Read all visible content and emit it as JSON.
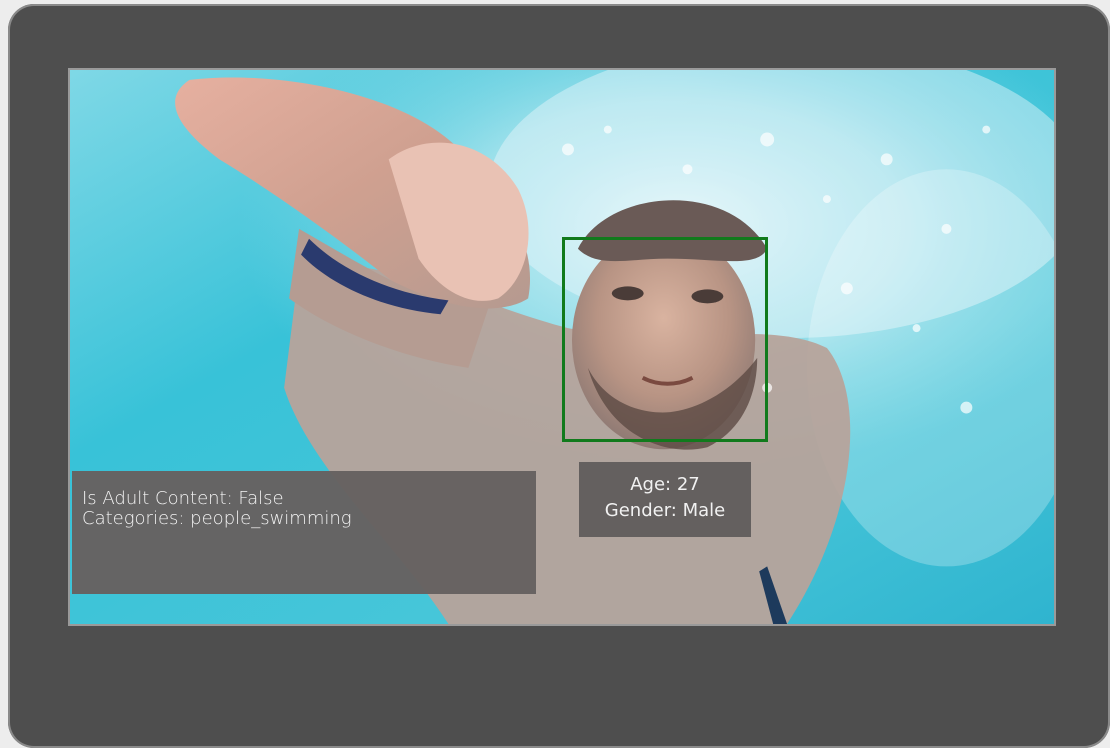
{
  "face": {
    "age_text": "Age: 27",
    "gender_text": "Gender: Male"
  },
  "analysis": {
    "adult_text": "Is Adult Content: False",
    "categories_text": "Categories: people_swimming"
  },
  "colors": {
    "frame": "#4e4e4e",
    "face_box": "#117a1c",
    "label_bg": "#605c5c",
    "water": "#37c0d6"
  },
  "image": {
    "subject": "swimmer-underwater-photo"
  }
}
